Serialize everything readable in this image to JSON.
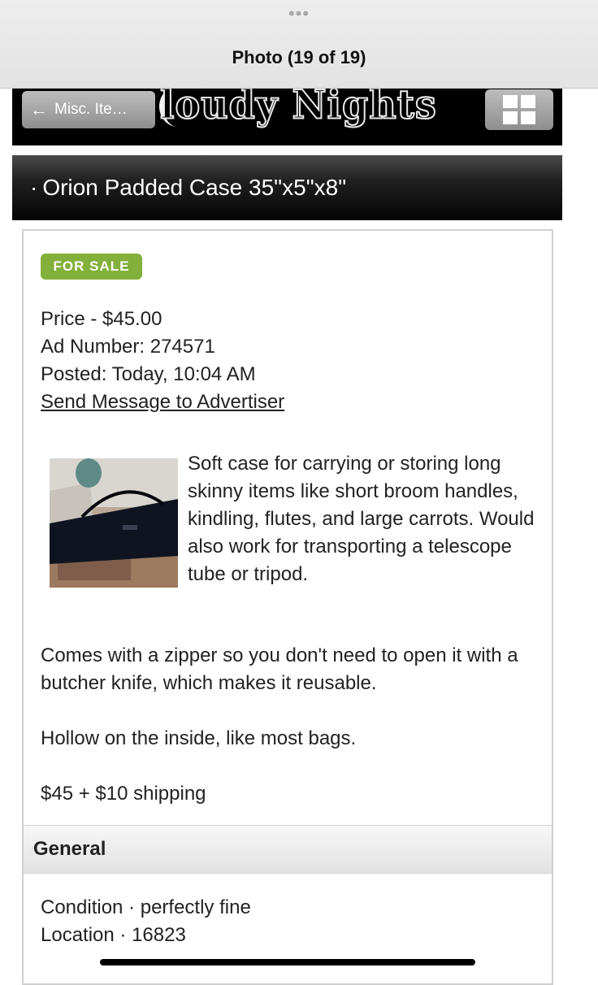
{
  "viewer": {
    "title": "Photo (19 of 19)",
    "more_icon": "ellipsis-icon"
  },
  "site_header": {
    "back_label": "Misc. Ite…",
    "logo_text": "loudy Nights",
    "grid_icon": "grid-icon"
  },
  "listing": {
    "title": "Orion Padded Case 35\"x5\"x8\"",
    "badge": "FOR SALE",
    "price": "Price - $45.00",
    "ad_number": "Ad Number: 274571",
    "posted": "Posted: Today, 10:04 AM",
    "send_message": "Send Message to Advertiser",
    "description": "Soft case for carrying or storing long skinny items like short broom handles, kindling, flutes, and large carrots. Would also work for transporting a telescope tube or tripod.",
    "paragraph_zipper": "Comes with a zipper so you don't need to open it with a butcher knife, which makes it reusable.",
    "paragraph_hollow": "Hollow on the inside, like most bags.",
    "paragraph_price": "$45 + $10 shipping"
  },
  "general": {
    "header": "General",
    "condition": "Condition · perfectly fine",
    "location": "Location · 16823"
  },
  "colors": {
    "badge_green": "#82b03b",
    "header_black": "#000000",
    "button_gray": "#a5a5a5"
  }
}
